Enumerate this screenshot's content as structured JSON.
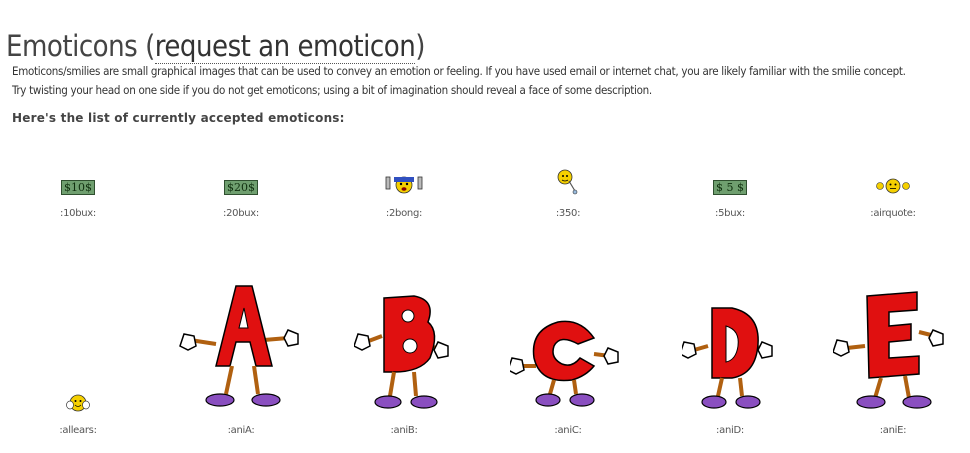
{
  "page": {
    "title": "Emoticons",
    "title_paren_open": "(",
    "request_link": "request an emoticon",
    "title_paren_close": ")",
    "intro_line1": "Emoticons/smilies are small graphical images that can be used to convey an emotion or feeling. If you have used email or internet chat, you are likely familiar with the smilie concept.",
    "intro_line2": "Try twisting your head on one side if you do not get emoticons; using a bit of imagination should reveal a face of some description.",
    "list_heading": "Here's the list of currently accepted emoticons:"
  },
  "emoticons": [
    {
      "code": ":10bux:",
      "bill": "$10$"
    },
    {
      "code": ":20bux:",
      "bill": "$20$"
    },
    {
      "code": ":2bong:"
    },
    {
      "code": ":350:"
    },
    {
      "code": ":5bux:",
      "bill": "$ 5 $"
    },
    {
      "code": ":airquote:"
    },
    {
      "code": ":allears:"
    },
    {
      "code": ":aniA:",
      "letter": "A"
    },
    {
      "code": ":aniB:",
      "letter": "B"
    },
    {
      "code": ":aniC:",
      "letter": "C"
    },
    {
      "code": ":aniD:",
      "letter": "D"
    },
    {
      "code": ":aniE:",
      "letter": "E"
    }
  ],
  "colors": {
    "bill_green": "#6f9f6f",
    "letter_red": "#e01010",
    "shoe_purple": "#8a4fc0",
    "smiley_yellow": "#f5d000"
  }
}
